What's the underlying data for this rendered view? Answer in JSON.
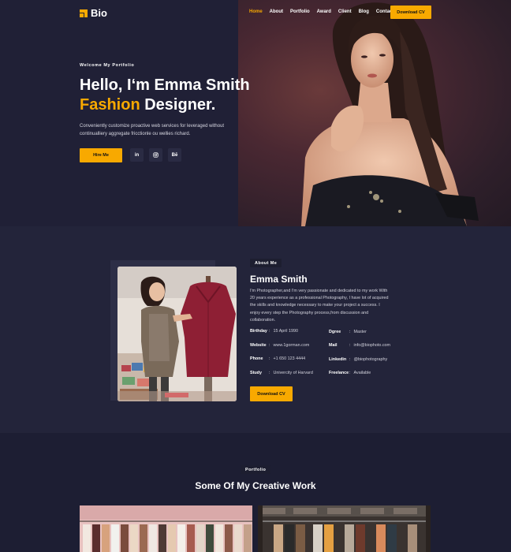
{
  "brand": {
    "name": "Bio",
    "accent": "#f8a900"
  },
  "nav": {
    "items": [
      "Home",
      "About",
      "Portfolio",
      "Award",
      "Client",
      "Blog",
      "Contact"
    ],
    "active": "Home",
    "cta": "Download CV"
  },
  "hero": {
    "eyebrow": "Welcome My Portfolio",
    "title_line1": "Hello, I‘m Emma Smith",
    "title_accent": "Fashion",
    "title_rest": " Designer.",
    "description": "Conveniently customize proactive web services for leveraged without continualliery aggregate fricctionle ou wellies richard.",
    "hire_label": "Hire Me",
    "socials": [
      "in",
      "instagram-icon",
      "Bē"
    ]
  },
  "about": {
    "eyebrow": "About Me",
    "name": "Emma Smith",
    "bio": "I'm Photographer,and I'm very passionate and dedicated to my work With 20 years experience as a professional Photography, I have lot of acquired the skills and knowledge necessary to make your project a success. I enjoy every step the Photography process,from discussion and collaboration.",
    "info_left": [
      {
        "key": "Birthday",
        "value": "15 April 1990"
      },
      {
        "key": "Website",
        "value": "www.1gorman.com"
      },
      {
        "key": "Phone",
        "value": "+1 650 123 4444"
      },
      {
        "key": "Study",
        "value": "Univercity of Harvard"
      }
    ],
    "info_right": [
      {
        "key": "Dgree",
        "value": "Master"
      },
      {
        "key": "Mail",
        "value": "info@biophoto.com"
      },
      {
        "key": "Linkedin",
        "value": "@biophotography"
      },
      {
        "key": "Freelance",
        "value": "Available"
      }
    ],
    "cv_label": "Download CV"
  },
  "portfolio": {
    "eyebrow": "Portfolio",
    "title": "Some Of My Creative Work"
  }
}
